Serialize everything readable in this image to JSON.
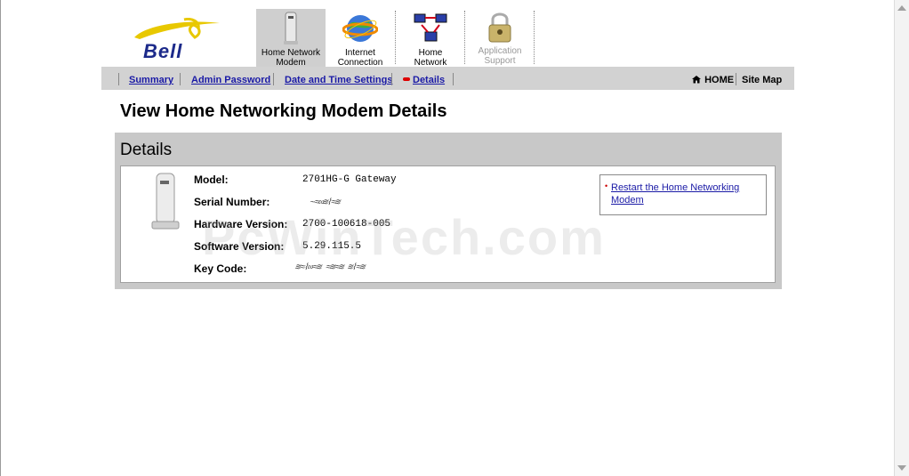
{
  "brand": {
    "logo_text": "Bell",
    "logo_color": "#1c2a8a",
    "swoosh_color": "#e8c800"
  },
  "top_tabs": [
    {
      "label": "Home Network\nModem",
      "icon": "modem-icon",
      "active": true
    },
    {
      "label": "Internet\nConnection",
      "icon": "globe-icon",
      "active": false
    },
    {
      "label": "Home\nNetwork",
      "icon": "network-computers-icon",
      "active": false
    },
    {
      "label": "Application\nSupport",
      "icon": "padlock-icon",
      "active": false,
      "disabled": true
    }
  ],
  "subnav": {
    "items": [
      "Summary",
      "Admin Password",
      "Date and Time Settings",
      "Details"
    ],
    "current": "Details",
    "home_label": "HOME",
    "sitemap_label": "Site Map"
  },
  "page": {
    "title": "View Home Networking Modem Details"
  },
  "details": {
    "heading": "Details",
    "fields": [
      {
        "label": "Model:",
        "value": "2701HG-G Gateway"
      },
      {
        "label": "Serial Number:",
        "value": "<scrambled>"
      },
      {
        "label": "Hardware Version:",
        "value": "2700-100618-005"
      },
      {
        "label": "Software Version:",
        "value": "5.29.115.5"
      },
      {
        "label": "Key Code:",
        "value": "<scrambled>"
      }
    ],
    "action_link": "Restart the Home Networking Modem"
  },
  "watermark": "PcWinTech.com",
  "colors": {
    "link": "#1a1aa6",
    "bar": "#d2d2d2",
    "panel": "#c8c8c8",
    "active_dot": "#dd0000"
  }
}
